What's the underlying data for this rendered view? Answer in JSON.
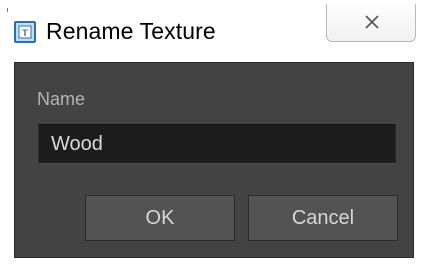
{
  "window": {
    "title": "Rename Texture",
    "close_icon": "close-icon",
    "app_icon": "texture-app-icon"
  },
  "form": {
    "name_label": "Name",
    "name_value": "Wood"
  },
  "buttons": {
    "ok_label": "OK",
    "cancel_label": "Cancel"
  },
  "colors": {
    "panel_background": "#434343",
    "input_background": "#1c1c1c",
    "button_background": "#535353"
  }
}
